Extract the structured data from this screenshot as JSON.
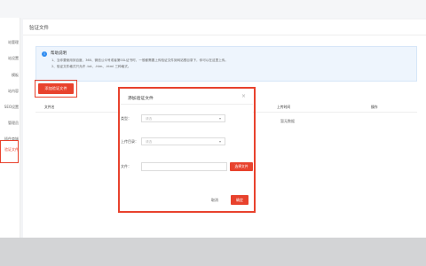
{
  "sidebar": {
    "items": [
      {
        "label": "站管理",
        "active": false
      },
      {
        "label": "站设置",
        "active": false
      },
      {
        "label": "模板",
        "active": false
      },
      {
        "label": "站内容",
        "active": false
      },
      {
        "label": "SEO设置",
        "active": false
      },
      {
        "label": "管理员",
        "active": false
      },
      {
        "label": "插件商城",
        "active": false
      },
      {
        "label": "验证文件",
        "active": true
      }
    ]
  },
  "main": {
    "title": "验证文件",
    "info": {
      "title": "帮助说明",
      "lines": [
        "1、当你要使用到百度、360、微信公众号或者第SSL证书时，一般都需要上传验证文件到网站根目录下，你可以在这里上传。",
        "2、验证文件格式只允许 .txt、.htm、.html 三种格式。"
      ]
    },
    "add_button": "添加验证文件",
    "table": {
      "headers": [
        "文件名",
        "上传时间",
        "操作"
      ],
      "empty_text": "暂无数据"
    }
  },
  "modal": {
    "title": "添加验证文件",
    "close_icon": "close-icon",
    "fields": {
      "type": {
        "label": "类型：",
        "placeholder": "请选"
      },
      "upload_dir": {
        "label": "上传目录：",
        "placeholder": "请选"
      },
      "file": {
        "label": "文件："
      }
    },
    "pick_file_button": "选择文件",
    "cancel_button": "取消",
    "confirm_button": "确定"
  },
  "colors": {
    "accent": "#e8422d",
    "info_bg": "#eef5fd",
    "info_icon": "#2f8cf0"
  }
}
